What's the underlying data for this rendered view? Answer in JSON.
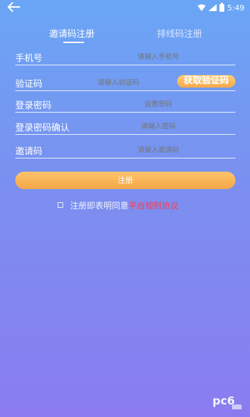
{
  "status_bar": {
    "time": "5:49"
  },
  "tabs": [
    {
      "label": "邀请码注册",
      "active": true
    },
    {
      "label": "排线码注册",
      "active": false
    }
  ],
  "form": {
    "phone": {
      "label": "手机号",
      "placeholder": "请输入手机号"
    },
    "code": {
      "label": "验证码",
      "placeholder": "请输入验证码",
      "get_code_label": "获取验证码"
    },
    "password": {
      "label": "登录密码",
      "placeholder": "设置密码"
    },
    "password_confirm": {
      "label": "登录密码确认",
      "placeholder": "请输入密码"
    },
    "invite": {
      "label": "邀请码",
      "placeholder": "请输入邀请码"
    }
  },
  "submit_label": "注册",
  "agreement": {
    "text": "注册即表明同意",
    "link": "平台规则协议"
  },
  "colors": {
    "bg_top": "#6aa6f5",
    "bg_bottom": "#8a7cf0",
    "accent": "#f7a94b",
    "link": "#ff3b4b"
  },
  "watermark": {
    "text": "pc6"
  }
}
